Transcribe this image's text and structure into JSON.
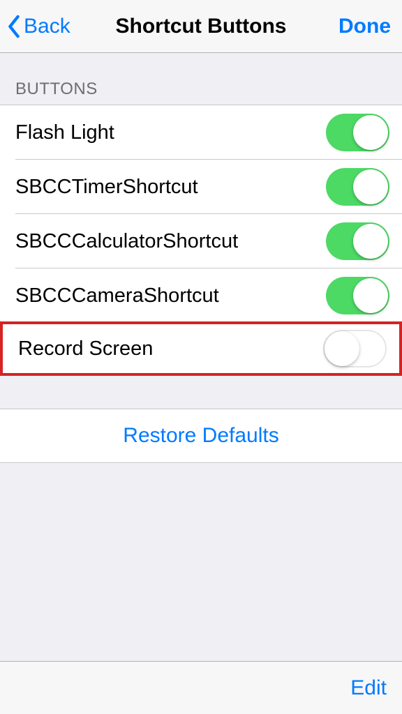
{
  "nav": {
    "back": "Back",
    "title": "Shortcut Buttons",
    "done": "Done"
  },
  "section_header": "BUTTONS",
  "rows": [
    {
      "label": "Flash Light",
      "on": true
    },
    {
      "label": "SBCCTimerShortcut",
      "on": true
    },
    {
      "label": "SBCCCalculatorShortcut",
      "on": true
    },
    {
      "label": "SBCCCameraShortcut",
      "on": true
    },
    {
      "label": "Record Screen",
      "on": false
    }
  ],
  "restore": "Restore Defaults",
  "toolbar": {
    "edit": "Edit"
  }
}
